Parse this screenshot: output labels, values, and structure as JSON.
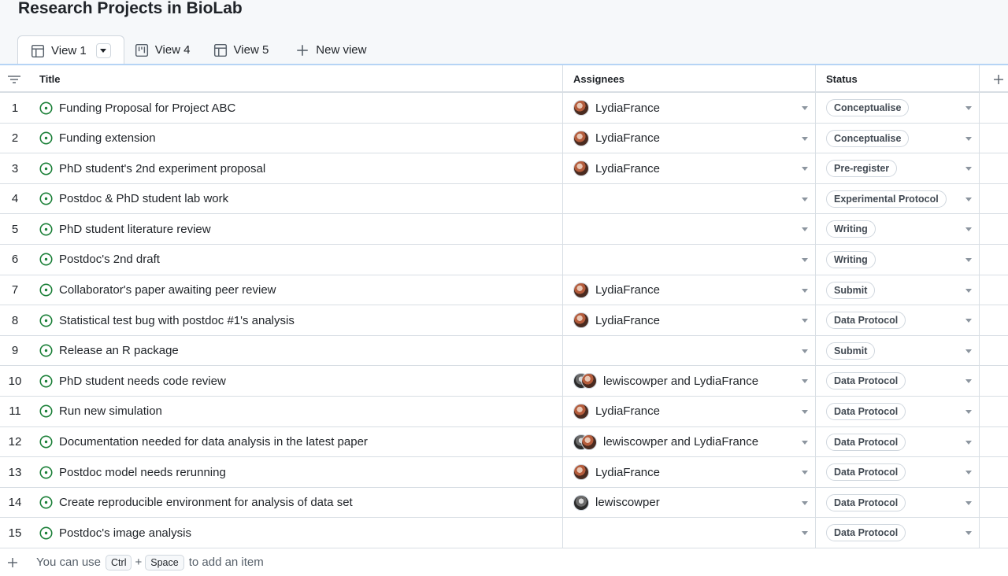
{
  "page": {
    "title": "Research Projects in BioLab"
  },
  "tabs": [
    {
      "label": "View 1",
      "icon": "table-icon",
      "active": true
    },
    {
      "label": "View 4",
      "icon": "board-icon",
      "active": false
    },
    {
      "label": "View 5",
      "icon": "table-icon",
      "active": false
    },
    {
      "label": "New view",
      "icon": "plus-icon",
      "active": false
    }
  ],
  "columns": {
    "title": "Title",
    "assignees": "Assignees",
    "status": "Status"
  },
  "rows": [
    {
      "num": "1",
      "title": "Funding Proposal for Project ABC",
      "assignees": "LydiaFrance",
      "avatars": [
        "lydia"
      ],
      "status": "Conceptualise"
    },
    {
      "num": "2",
      "title": "Funding extension",
      "assignees": "LydiaFrance",
      "avatars": [
        "lydia"
      ],
      "status": "Conceptualise"
    },
    {
      "num": "3",
      "title": "PhD student's 2nd experiment proposal",
      "assignees": "LydiaFrance",
      "avatars": [
        "lydia"
      ],
      "status": "Pre-register"
    },
    {
      "num": "4",
      "title": "Postdoc & PhD student lab work",
      "assignees": "",
      "avatars": [],
      "status": "Experimental Protocol"
    },
    {
      "num": "5",
      "title": "PhD student literature review",
      "assignees": "",
      "avatars": [],
      "status": "Writing"
    },
    {
      "num": "6",
      "title": "Postdoc's 2nd draft",
      "assignees": "",
      "avatars": [],
      "status": "Writing"
    },
    {
      "num": "7",
      "title": "Collaborator's paper awaiting peer review",
      "assignees": "LydiaFrance",
      "avatars": [
        "lydia"
      ],
      "status": "Submit"
    },
    {
      "num": "8",
      "title": "Statistical test bug with postdoc #1's analysis",
      "assignees": "LydiaFrance",
      "avatars": [
        "lydia"
      ],
      "status": "Data Protocol"
    },
    {
      "num": "9",
      "title": "Release an R package",
      "assignees": "",
      "avatars": [],
      "status": "Submit"
    },
    {
      "num": "10",
      "title": "PhD student needs code review",
      "assignees": "lewiscowper and LydiaFrance",
      "avatars": [
        "lewis",
        "lydia"
      ],
      "status": "Data Protocol"
    },
    {
      "num": "11",
      "title": "Run new simulation",
      "assignees": "LydiaFrance",
      "avatars": [
        "lydia"
      ],
      "status": "Data Protocol"
    },
    {
      "num": "12",
      "title": "Documentation needed for data analysis in the latest paper",
      "assignees": "lewiscowper and LydiaFrance",
      "avatars": [
        "lewis",
        "lydia"
      ],
      "status": "Data Protocol"
    },
    {
      "num": "13",
      "title": "Postdoc model needs rerunning",
      "assignees": "LydiaFrance",
      "avatars": [
        "lydia"
      ],
      "status": "Data Protocol"
    },
    {
      "num": "14",
      "title": "Create reproducible environment for analysis of data set",
      "assignees": "lewiscowper",
      "avatars": [
        "lewis"
      ],
      "status": "Data Protocol"
    },
    {
      "num": "15",
      "title": "Postdoc's image analysis",
      "assignees": "",
      "avatars": [],
      "status": "Data Protocol"
    }
  ],
  "footer": {
    "prefix": "You can use",
    "key1": "Ctrl",
    "plus": "+",
    "key2": "Space",
    "suffix": "to add an item"
  },
  "colors": {
    "accent_line": "#b6d4f5",
    "open_issue": "#1a7f37",
    "border": "#d8dee4"
  }
}
